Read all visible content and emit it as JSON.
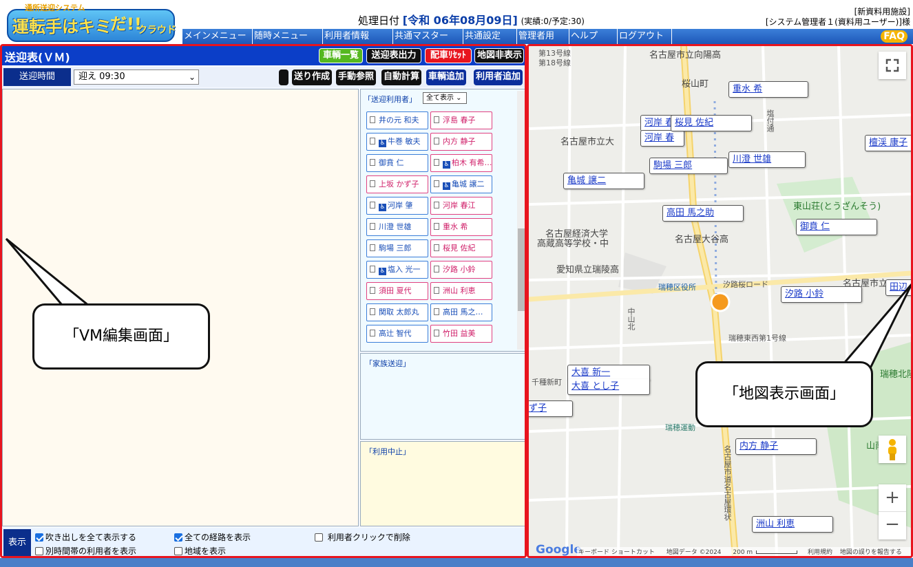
{
  "header": {
    "logo_sub": "通所送迎システム",
    "logo_main": "運転手はキミ",
    "logo_da": "だ!!",
    "logo_cloud": "クラウド",
    "date_label": "処理日付",
    "date_value": "[令和 06年08月09日]",
    "counts": "(実績:0/予定:30)",
    "facility": "[新資料用施設]",
    "user": "[システム管理者１(資料用ユーザー)]様",
    "faq": "FAQ"
  },
  "menu": [
    "メインメニュー",
    "随時メニュー",
    "利用者情報",
    "共通マスター",
    "共通設定",
    "管理者用",
    "ヘルプ",
    "ログアウト"
  ],
  "panel": {
    "title": "送迎表(ＶＭ)",
    "top_buttons": [
      "車輌一覧",
      "送迎表出力",
      "配車ﾘｾｯﾄ",
      "地図非表示"
    ],
    "time_label": "送迎時間",
    "time_value": "迎え 09:30",
    "action_buttons": [
      "送り作成",
      "手動参照",
      "自動計算",
      "車輌追加",
      "利用者追加"
    ],
    "vm_callout": "「VM編集画面」",
    "rider_title": "「送迎利用者」",
    "show_all": "全て表示",
    "family_title": "「家族送迎」",
    "stop_title": "「利用中止」",
    "options_label": "表示",
    "options": [
      {
        "label": "吹き出しを全て表示する",
        "checked": true
      },
      {
        "label": "全ての経路を表示",
        "checked": true
      },
      {
        "label": "利用者クリックで削除",
        "checked": false
      },
      {
        "label": "別時間帯の利用者を表示",
        "checked": false
      },
      {
        "label": "地域を表示",
        "checked": false
      }
    ]
  },
  "riders": [
    [
      "井の元 和夫",
      "浮島 春子"
    ],
    [
      "牛巻 敏夫",
      "内方 静子"
    ],
    [
      "御賁 仁",
      "柏木 有希…"
    ],
    [
      "上坂 かず子",
      "亀城 譲二"
    ],
    [
      "河岸 肇",
      "河岸 春江"
    ],
    [
      "川澄 世雄",
      "重水 希"
    ],
    [
      "駒場 三郎",
      "桜見 佐紀"
    ],
    [
      "塩入 光一",
      "汐路 小鈴"
    ],
    [
      "須田 夏代",
      "洲山 利恵"
    ],
    [
      "関取 太郎丸",
      "高田 馬之…"
    ],
    [
      "高辻 智代",
      "竹田 益美"
    ]
  ],
  "map": {
    "callout": "「地図表示画面」",
    "markers": [
      "重水 希",
      "河岸 春",
      "河岸 春",
      "桜見 佐紀",
      "駒場 三郎",
      "川澄 世雄",
      "檀渓 康子",
      "亀城 譲二",
      "高田 馬之助",
      "御賁 仁",
      "汐路 小鈴",
      "田辺",
      "大喜 新一",
      "大喜 とし子",
      "ず子",
      "内方 静子",
      "洲山 利恵"
    ],
    "places": [
      "名古屋市立向陽高",
      "桜山町",
      "塩付通",
      "名古屋市立大",
      "東山荘(とうざんそう)",
      "名古屋経済大学",
      "高蔵高等学校・中",
      "名古屋大谷高",
      "愛知県立瑞陵高",
      "瑞穂区役所",
      "汐路桜ロード",
      "名古屋市立",
      "中山北",
      "瑞穂東西第1号線",
      "瑞穂運動",
      "名古屋市道名古屋環状",
      "千種新町",
      "山南公園",
      "瑞穂北陵"
    ],
    "footer": [
      "キーボード ショートカット",
      "地図データ ©2024",
      "200 m",
      "利用規約",
      "地図の誤りを報告する"
    ],
    "google": "Google"
  }
}
